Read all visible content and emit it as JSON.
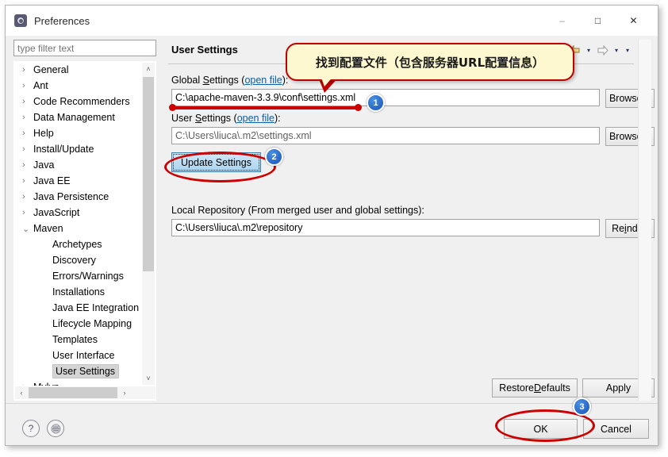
{
  "window": {
    "title": "Preferences",
    "icon": "preferences-gear-icon",
    "minimize_label": "–",
    "maximize_label": "□",
    "close_label": "✕"
  },
  "sidebar": {
    "filter_placeholder": "type filter text",
    "filter_value": "",
    "items": [
      {
        "label": "General",
        "arrow": "›",
        "level": 0,
        "selected": false
      },
      {
        "label": "Ant",
        "arrow": "›",
        "level": 0,
        "selected": false
      },
      {
        "label": "Code Recommenders",
        "arrow": "›",
        "level": 0,
        "selected": false
      },
      {
        "label": "Data Management",
        "arrow": "›",
        "level": 0,
        "selected": false
      },
      {
        "label": "Help",
        "arrow": "›",
        "level": 0,
        "selected": false
      },
      {
        "label": "Install/Update",
        "arrow": "›",
        "level": 0,
        "selected": false
      },
      {
        "label": "Java",
        "arrow": "›",
        "level": 0,
        "selected": false
      },
      {
        "label": "Java EE",
        "arrow": "›",
        "level": 0,
        "selected": false
      },
      {
        "label": "Java Persistence",
        "arrow": "›",
        "level": 0,
        "selected": false
      },
      {
        "label": "JavaScript",
        "arrow": "›",
        "level": 0,
        "selected": false
      },
      {
        "label": "Maven",
        "arrow": "⌄",
        "level": 0,
        "selected": false
      },
      {
        "label": "Archetypes",
        "arrow": "",
        "level": 1,
        "selected": false
      },
      {
        "label": "Discovery",
        "arrow": "",
        "level": 1,
        "selected": false
      },
      {
        "label": "Errors/Warnings",
        "arrow": "",
        "level": 1,
        "selected": false
      },
      {
        "label": "Installations",
        "arrow": "",
        "level": 1,
        "selected": false
      },
      {
        "label": "Java EE Integration",
        "arrow": "",
        "level": 1,
        "selected": false
      },
      {
        "label": "Lifecycle Mapping",
        "arrow": "",
        "level": 1,
        "selected": false
      },
      {
        "label": "Templates",
        "arrow": "",
        "level": 1,
        "selected": false
      },
      {
        "label": "User Interface",
        "arrow": "",
        "level": 1,
        "selected": false
      },
      {
        "label": "User Settings",
        "arrow": "",
        "level": 1,
        "selected": true
      },
      {
        "label": "Mylyn",
        "arrow": "›",
        "level": 0,
        "selected": false
      }
    ],
    "scroll_up_icon": "˄",
    "scroll_down_icon": "˅",
    "scroll_left_icon": "‹",
    "scroll_right_icon": "›"
  },
  "main": {
    "page_title": "User Settings",
    "nav": {
      "back_icon": "back-arrow-icon",
      "back_caret": "▾",
      "forward_icon": "forward-arrow-icon",
      "forward_caret": "▾",
      "menu_caret": "▾"
    },
    "global_settings": {
      "label_prefix": "Global ",
      "label_mnemonic": "S",
      "label_rest": "ettings",
      "link": "open file",
      "label_suffix": "):",
      "label_open_paren": " (",
      "value": "C:\\apache-maven-3.3.9\\conf\\settings.xml",
      "browse_label": "Browse..."
    },
    "user_settings": {
      "label_prefix": "User ",
      "label_mnemonic": "S",
      "label_rest": "ettings",
      "link": "open file",
      "label_open_paren": " (",
      "label_suffix": "):",
      "value": "C:\\Users\\liuca\\.m2\\settings.xml",
      "browse_label": "Browse..."
    },
    "update_settings_label": "Update Settings",
    "local_repository": {
      "label": "Local Repository (From merged user and global settings):",
      "value": "C:\\Users\\liuca\\.m2\\repository",
      "reindex_prefix": "Re",
      "reindex_mnemonic": "i",
      "reindex_rest": "ndex"
    },
    "restore_defaults": {
      "prefix": "Restore ",
      "mnemonic": "D",
      "rest": "efaults"
    },
    "apply_label": "Apply"
  },
  "footer": {
    "help_icon": "?",
    "secondary_icon": "disabled-circle-icon",
    "ok_label": "OK",
    "cancel_label": "Cancel"
  },
  "annotations": {
    "callout_text": "找到配置文件（包含服务器URL配置信息）",
    "badge_1": "1",
    "badge_2": "2",
    "badge_3": "3",
    "highlight_color": "#cc0000",
    "callout_fill": "#fdf8cf",
    "badge_color": "#1a53b8"
  }
}
